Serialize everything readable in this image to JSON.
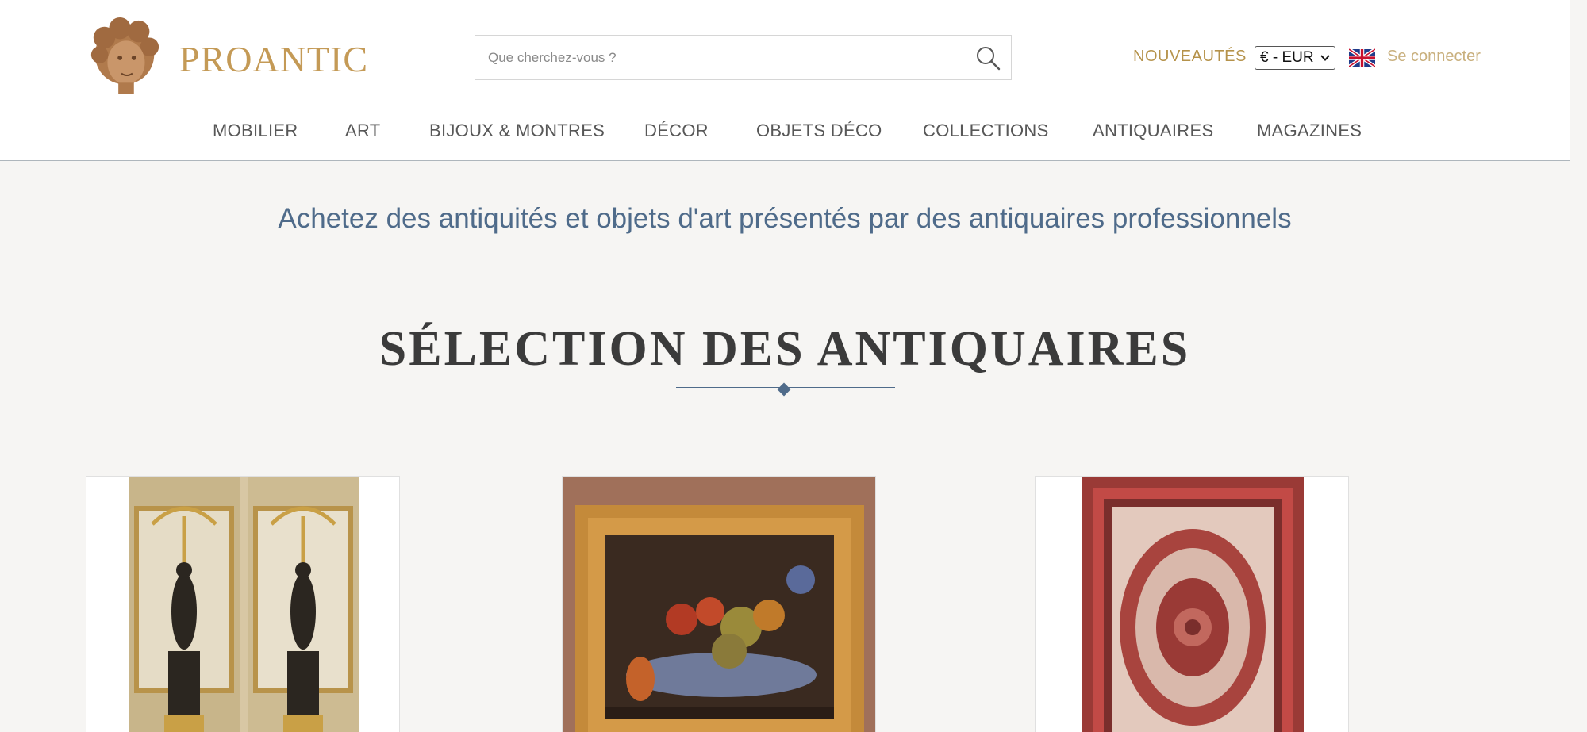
{
  "header": {
    "logo_text": "PROANTIC",
    "search": {
      "placeholder": "Que cherchez-vous ?"
    },
    "nouveautes_label": "NOUVEAUTÉS",
    "currency": "€ - EUR",
    "language_icon": "uk-flag-icon",
    "login_label": "Se connecter"
  },
  "nav": {
    "items": [
      {
        "label": "MOBILIER"
      },
      {
        "label": "ART"
      },
      {
        "label": "BIJOUX & MONTRES"
      },
      {
        "label": "DÉCOR"
      },
      {
        "label": "OBJETS DÉCO"
      },
      {
        "label": "COLLECTIONS"
      },
      {
        "label": "ANTIQUAIRES"
      },
      {
        "label": "MAGAZINES"
      }
    ]
  },
  "main": {
    "tagline": "Achetez des antiquités et objets d'art présentés par des antiquaires professionnels",
    "section_title": "SÉLECTION DES ANTIQUAIRES",
    "products": [
      {
        "image": "gilt-candelabra-pair-photo"
      },
      {
        "image": "still-life-painting-photo"
      },
      {
        "image": "oriental-rug-photo"
      }
    ]
  },
  "colors": {
    "brand_gold": "#c49a56",
    "nav_text": "#575757",
    "tagline_blue": "#4f6b8a",
    "background": "#f6f5f3"
  }
}
